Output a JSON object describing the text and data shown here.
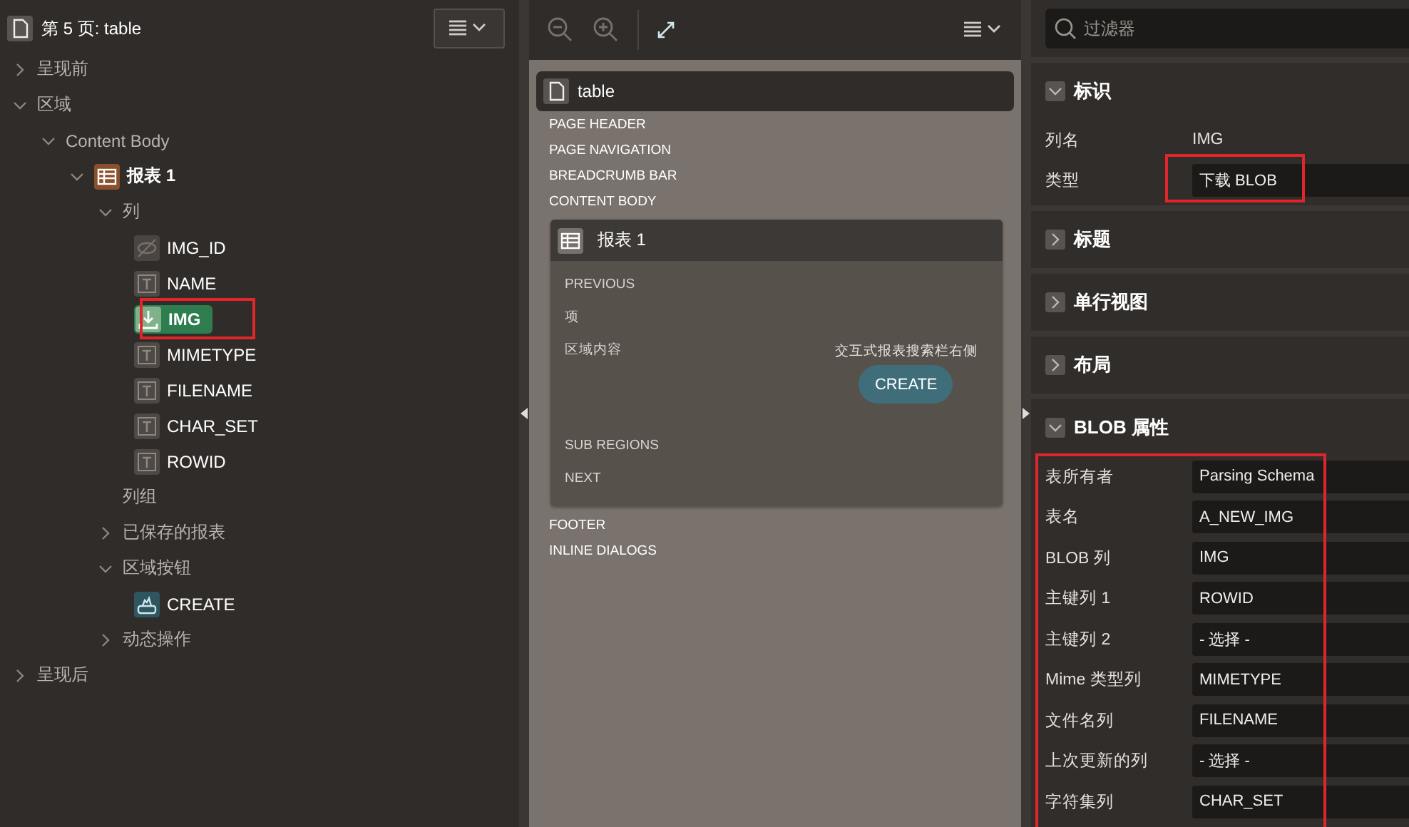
{
  "tree": {
    "title": "第 5 页: table",
    "nodes": [
      {
        "label": "呈现前",
        "kind": "folder",
        "expanded": false
      },
      {
        "label": "区域",
        "kind": "folder",
        "expanded": true,
        "children": [
          {
            "label": "Content Body",
            "kind": "folder",
            "expanded": true,
            "children": [
              {
                "label": "报表 1",
                "kind": "report",
                "expanded": true,
                "children": [
                  {
                    "label": "列",
                    "kind": "folder",
                    "expanded": true,
                    "children": [
                      {
                        "label": "IMG_ID",
                        "kind": "hidden-column",
                        "selected": false
                      },
                      {
                        "label": "NAME",
                        "kind": "text-column",
                        "selected": false
                      },
                      {
                        "label": "IMG",
                        "kind": "download-column",
                        "selected": true,
                        "annotated": true
                      },
                      {
                        "label": "MIMETYPE",
                        "kind": "text-column",
                        "selected": false
                      },
                      {
                        "label": "FILENAME",
                        "kind": "text-column",
                        "selected": false
                      },
                      {
                        "label": "CHAR_SET",
                        "kind": "text-column",
                        "selected": false
                      },
                      {
                        "label": "ROWID",
                        "kind": "text-column",
                        "selected": false
                      }
                    ]
                  },
                  {
                    "label": "列组",
                    "kind": "folder"
                  },
                  {
                    "label": "已保存的报表",
                    "kind": "folder",
                    "expanded": false
                  },
                  {
                    "label": "区域按钮",
                    "kind": "folder",
                    "expanded": true,
                    "children": [
                      {
                        "label": "CREATE",
                        "kind": "button",
                        "selected": false
                      }
                    ]
                  },
                  {
                    "label": "动态操作",
                    "kind": "folder",
                    "expanded": false
                  }
                ]
              }
            ]
          }
        ]
      },
      {
        "label": "呈现后",
        "kind": "folder",
        "expanded": false
      }
    ]
  },
  "layout": {
    "page_title": "table",
    "positions_top": [
      "PAGE HEADER",
      "PAGE NAVIGATION",
      "BREADCRUMB BAR",
      "CONTENT BODY"
    ],
    "region": {
      "title": "报表 1",
      "slots_top": [
        "PREVIOUS",
        "项"
      ],
      "content_slot": "区域内容",
      "right_slot": "交互式报表搜索栏右侧",
      "button": "CREATE",
      "slots_bottom": [
        "SUB REGIONS",
        "NEXT"
      ]
    },
    "positions_bottom": [
      "FOOTER",
      "INLINE DIALOGS"
    ]
  },
  "properties": {
    "search": {
      "placeholder": "过滤器"
    },
    "groups": [
      {
        "title": "标识",
        "expanded": true,
        "rows": [
          {
            "label": "列名",
            "value": "IMG",
            "kind": "text"
          },
          {
            "label": "类型",
            "value": "下载 BLOB",
            "kind": "field",
            "annotated": true
          }
        ]
      },
      {
        "title": "标题",
        "expanded": false
      },
      {
        "title": "单行视图",
        "expanded": false
      },
      {
        "title": "布局",
        "expanded": false
      },
      {
        "title": "BLOB 属性",
        "expanded": true,
        "annotated": true,
        "rows": [
          {
            "label": "表所有者",
            "value": "Parsing Schema",
            "kind": "field"
          },
          {
            "label": "表名",
            "value": "A_NEW_IMG",
            "kind": "field"
          },
          {
            "label": "BLOB 列",
            "value": "IMG",
            "kind": "field"
          },
          {
            "label": "主键列 1",
            "value": "ROWID",
            "kind": "field"
          },
          {
            "label": "主键列 2",
            "value": "- 选择 -",
            "kind": "field"
          },
          {
            "label": "Mime 类型列",
            "value": "MIMETYPE",
            "kind": "field"
          },
          {
            "label": "文件名列",
            "value": "FILENAME",
            "kind": "field"
          },
          {
            "label": "上次更新的列",
            "value": "- 选择 -",
            "kind": "field"
          },
          {
            "label": "字符集列",
            "value": "CHAR_SET",
            "kind": "field"
          }
        ]
      }
    ]
  }
}
